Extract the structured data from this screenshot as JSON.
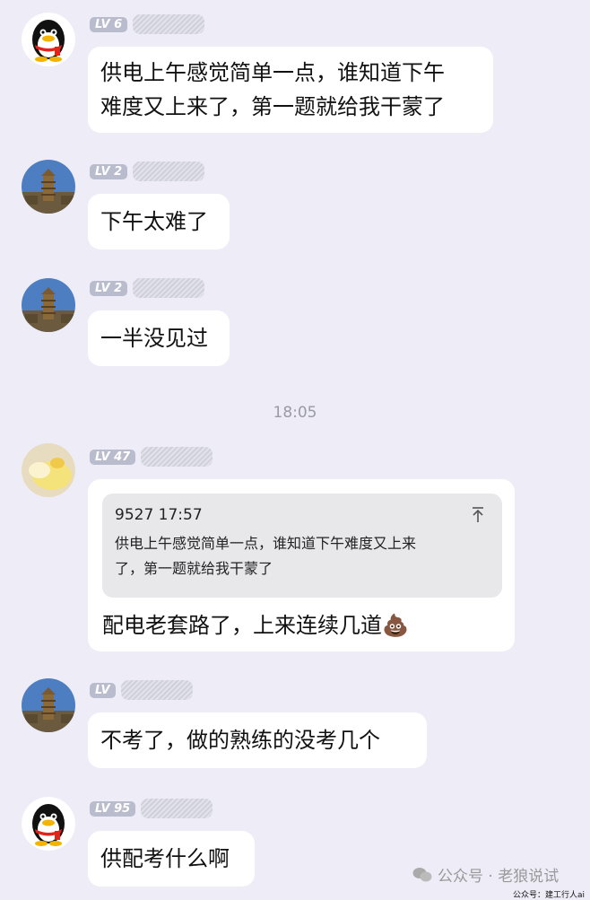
{
  "messages": [
    {
      "level": "LV 6",
      "text_line1": "供电上午感觉简单一点，谁知道下午",
      "text_line2": "难度又上来了，第一题就给我干蒙了",
      "avatar": "penguin-avatar"
    },
    {
      "level": "LV 2",
      "text": "下午太难了",
      "avatar": "pagoda-avatar"
    },
    {
      "level": "LV 2",
      "text": "一半没见过",
      "avatar": "pagoda-avatar"
    },
    {
      "level": "LV 47",
      "quote_header": "9527 17:57",
      "quote_line1": "供电上午感觉简单一点，谁知道下午难度又上来",
      "quote_line2": "了，第一题就给我干蒙了",
      "text": "配电老套路了，上来连续几道💩",
      "avatar": "duck-avatar"
    },
    {
      "level": "LV",
      "text": "不考了，做的熟练的没考几个",
      "avatar": "pagoda-avatar"
    },
    {
      "level": "LV 95",
      "text": "供配考什么啊",
      "avatar": "penguin-avatar"
    }
  ],
  "timestamp": "18:05",
  "footer": {
    "wechat": "公众号 · 老狼说试",
    "credit": "公众号：建工行人ai"
  }
}
